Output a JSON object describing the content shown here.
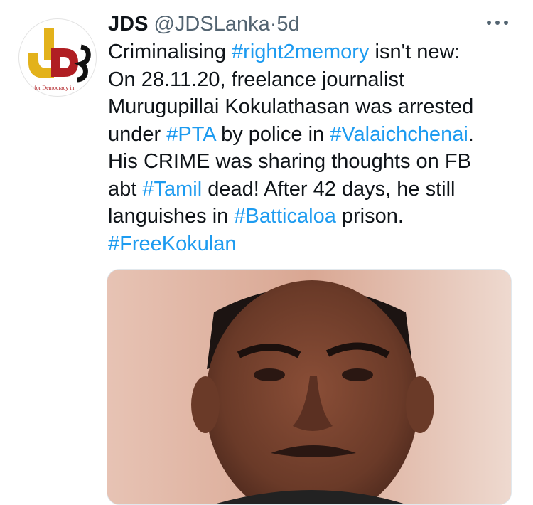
{
  "tweet": {
    "author": {
      "name": "JDS",
      "handle": "@JDSLanka",
      "avatar_alt": "JDS for Democracy logo",
      "avatar_letters": "JDS",
      "avatar_tagline": "for Democracy in"
    },
    "separator": "·",
    "time": "5d",
    "more_icon": "more-horizontal-icon",
    "lines": [
      [
        {
          "t": "Criminalising "
        },
        {
          "t": "#right2memory",
          "tag": true
        },
        {
          "t": " isn't new:"
        }
      ],
      [
        {
          "t": "On 28.11.20, freelance journalist"
        }
      ],
      [
        {
          "t": "Murugupillai Kokulathasan was arrested"
        }
      ],
      [
        {
          "t": "under "
        },
        {
          "t": "#PTA",
          "tag": true
        },
        {
          "t": " by police in "
        },
        {
          "t": "#Valaichchenai",
          "tag": true
        },
        {
          "t": "."
        }
      ],
      [
        {
          "t": "His CRIME was sharing thoughts on FB"
        }
      ],
      [
        {
          "t": "abt "
        },
        {
          "t": "#Tamil",
          "tag": true
        },
        {
          "t": " dead! After 42 days, he still"
        }
      ],
      [
        {
          "t": "languishes in "
        },
        {
          "t": "#Batticaloa",
          "tag": true
        },
        {
          "t": " prison."
        }
      ],
      [
        {
          "t": "#FreeKokulan",
          "tag": true
        }
      ]
    ],
    "media": {
      "alt": "Photo of a man"
    }
  },
  "colors": {
    "hashtag": "#1d9bf0",
    "text": "#0f1419",
    "secondary": "#536471",
    "logo_yellow": "#e3b21b",
    "logo_red": "#b01e23"
  }
}
